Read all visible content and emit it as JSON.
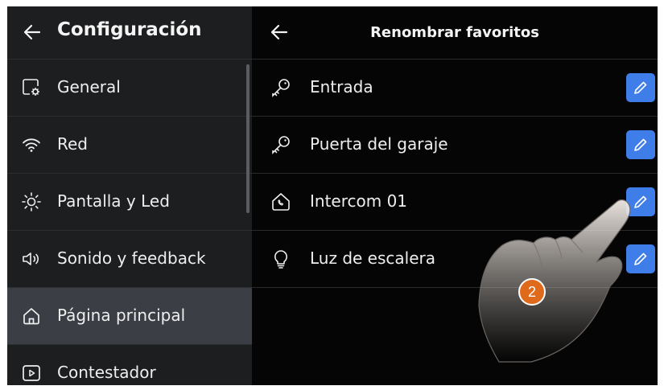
{
  "left_panel": {
    "title": "Configuración",
    "items": [
      {
        "label": "General",
        "icon": "gear-window-icon"
      },
      {
        "label": "Red",
        "icon": "wifi-icon"
      },
      {
        "label": "Pantalla y Led",
        "icon": "sun-icon"
      },
      {
        "label": "Sonido y feedback",
        "icon": "speaker-icon"
      },
      {
        "label": "Página principal",
        "icon": "home-icon",
        "active": true
      },
      {
        "label": "Contestador",
        "icon": "play-box-icon"
      }
    ]
  },
  "right_panel": {
    "title": "Renombrar favoritos",
    "items": [
      {
        "label": "Entrada",
        "icon": "key-icon"
      },
      {
        "label": "Puerta del garaje",
        "icon": "key-icon"
      },
      {
        "label": "Intercom 01",
        "icon": "intercom-icon"
      },
      {
        "label": "Luz de escalera",
        "icon": "lightbulb-icon"
      }
    ]
  },
  "annotation": {
    "step": "2"
  },
  "colors": {
    "accent": "#3f7de8",
    "active_bg": "#3b3e45",
    "left_bg": "#1d1e20",
    "badge": "#e06a1c"
  }
}
